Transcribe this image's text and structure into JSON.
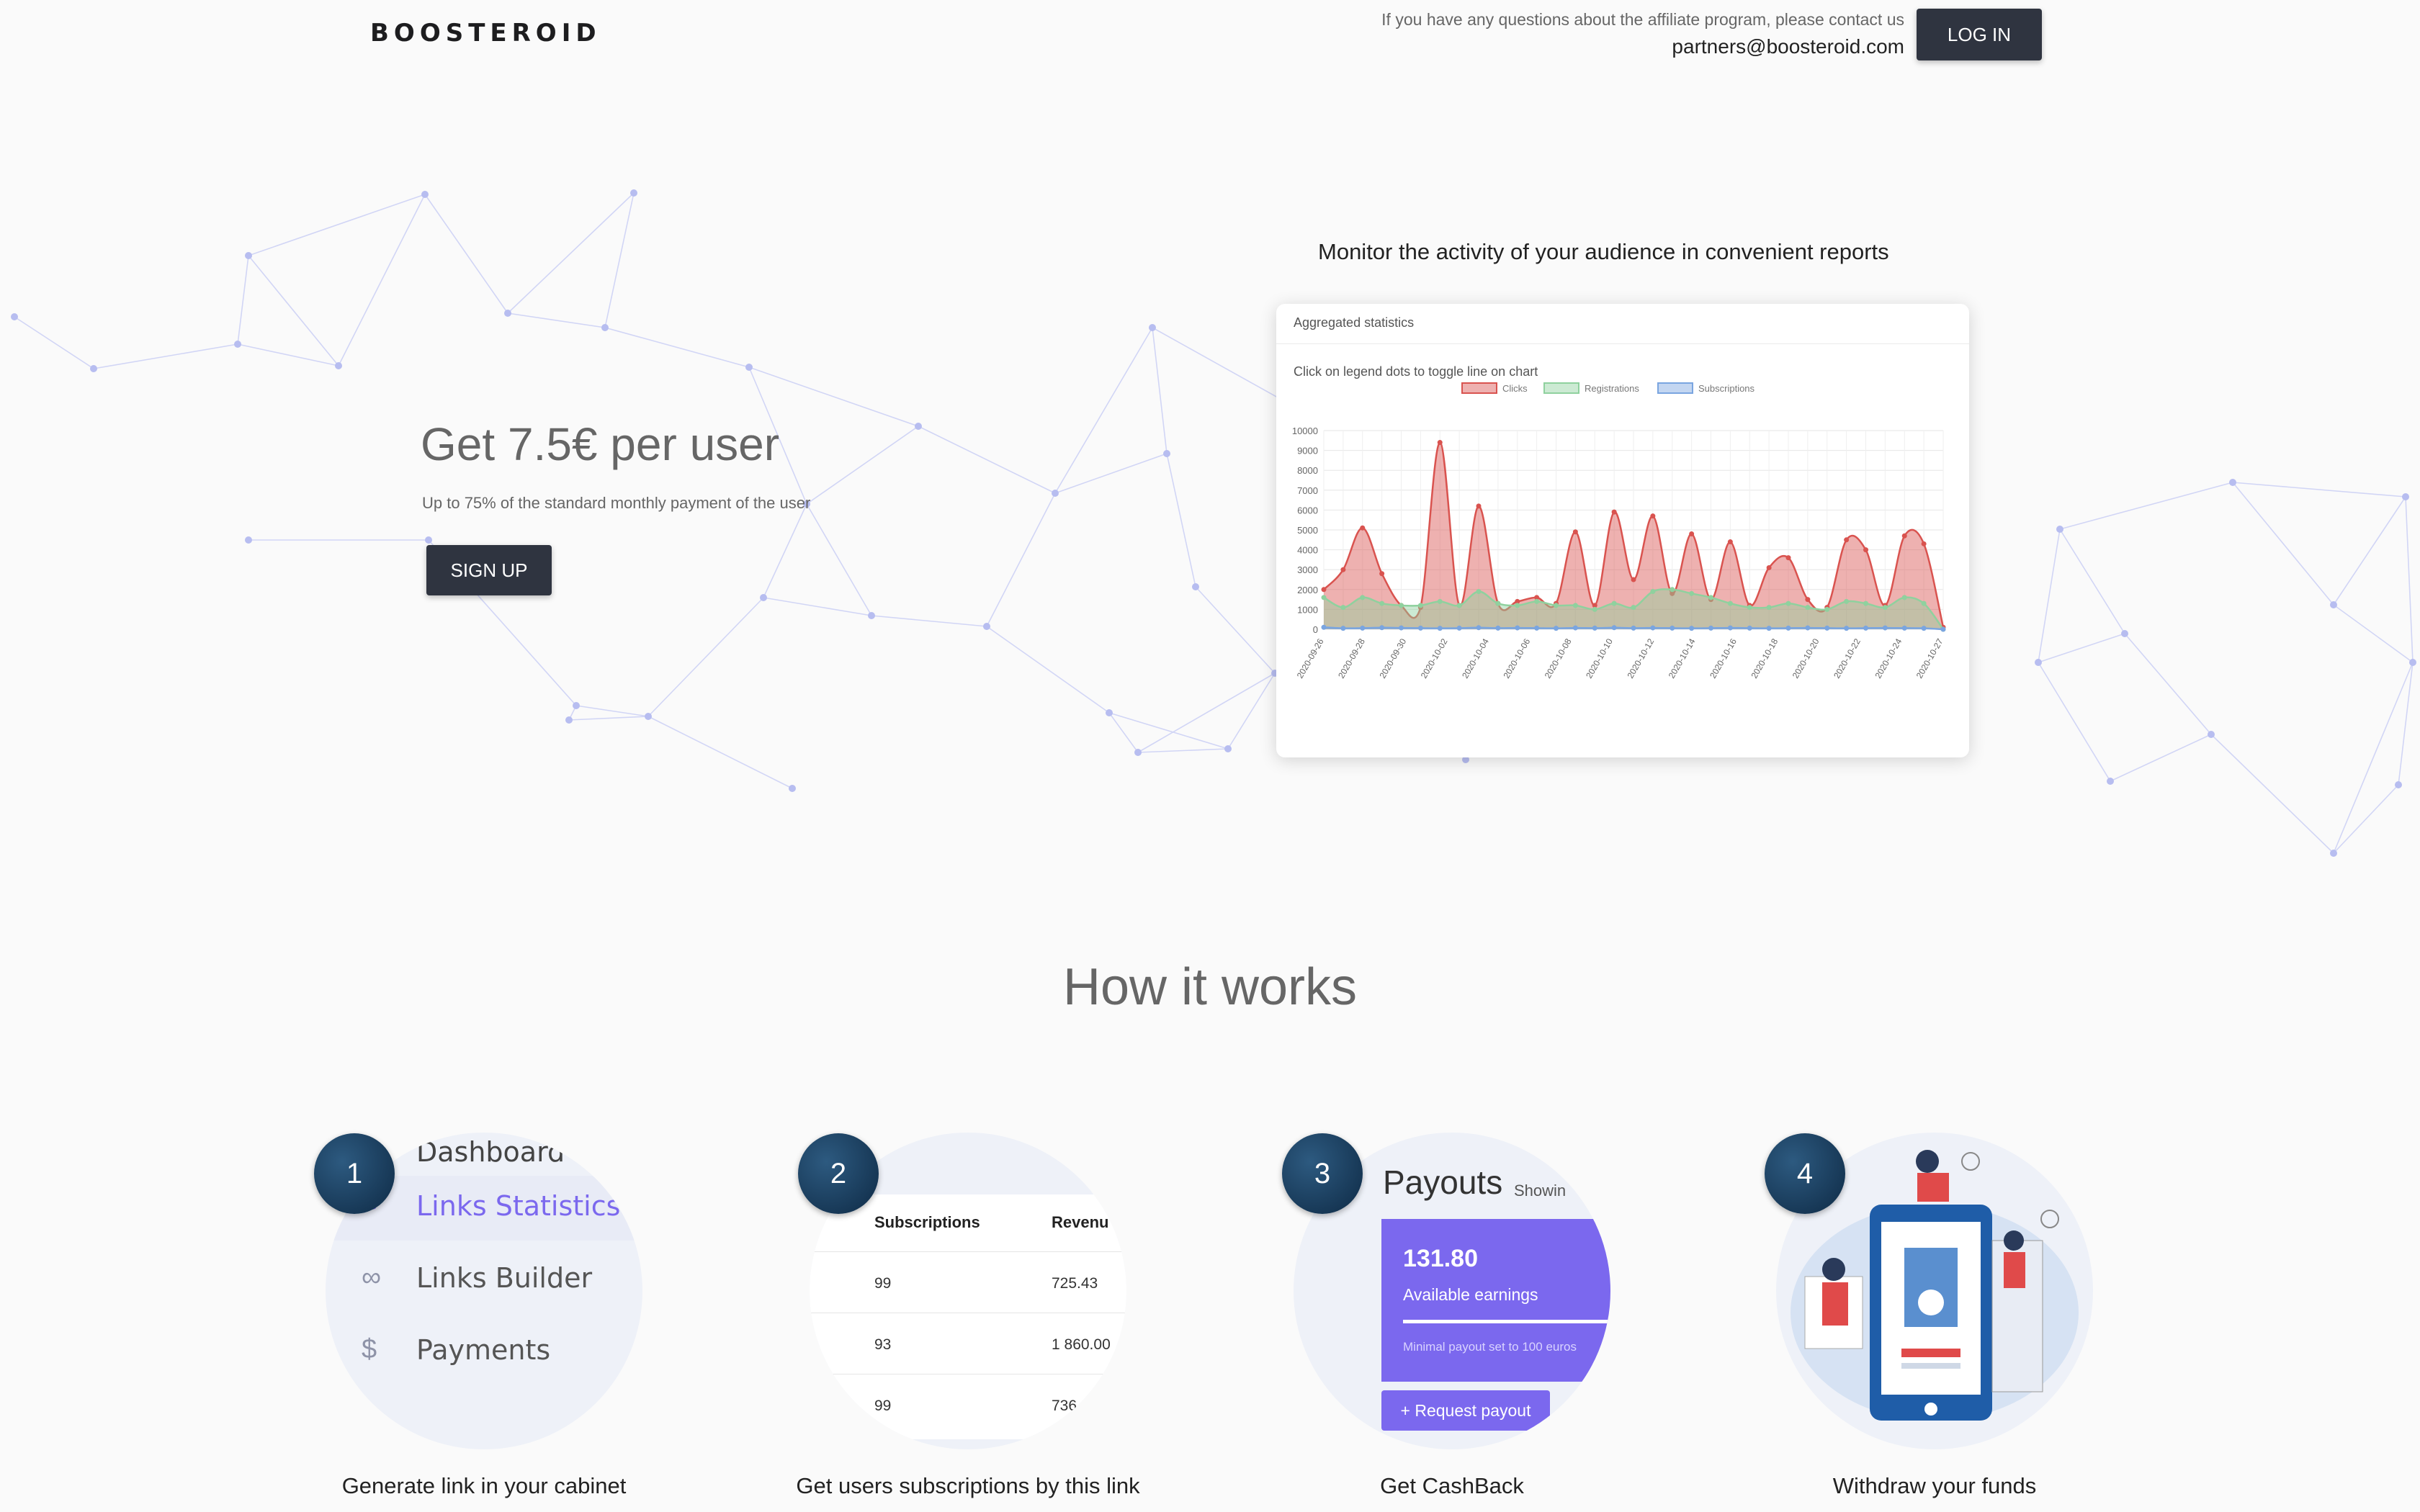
{
  "header": {
    "logo": "BOOSTEROID",
    "contact_question": "If you have any questions about the affiliate program, please contact us",
    "contact_email": "partners@boosteroid.com",
    "login_label": "LOG IN"
  },
  "hero": {
    "title": "Get 7.5€ per user",
    "subtitle": "Up to 75% of the standard monthly payment of the user",
    "signup_label": "SIGN UP"
  },
  "report": {
    "caption": "Monitor the activity of your audience in convenient reports",
    "card_title": "Aggregated statistics",
    "hint": "Click on legend dots to toggle line on chart"
  },
  "chart_data": {
    "type": "area",
    "title": "",
    "x": [
      "2020-09-26",
      "2020-09-27",
      "2020-09-28",
      "2020-09-29",
      "2020-09-30",
      "2020-10-01",
      "2020-10-02",
      "2020-10-03",
      "2020-10-04",
      "2020-10-05",
      "2020-10-06",
      "2020-10-07",
      "2020-10-08",
      "2020-10-09",
      "2020-10-10",
      "2020-10-11",
      "2020-10-12",
      "2020-10-13",
      "2020-10-14",
      "2020-10-15",
      "2020-10-16",
      "2020-10-17",
      "2020-10-18",
      "2020-10-19",
      "2020-10-20",
      "2020-10-21",
      "2020-10-22",
      "2020-10-23",
      "2020-10-24",
      "2020-10-25",
      "2020-10-26",
      "2020-10-27"
    ],
    "x_tick_labels": [
      "2020-09-26",
      "2020-09-28",
      "2020-09-30",
      "2020-10-02",
      "2020-10-04",
      "2020-10-06",
      "2020-10-08",
      "2020-10-10",
      "2020-10-12",
      "2020-10-14",
      "2020-10-16",
      "2020-10-18",
      "2020-10-20",
      "2020-10-22",
      "2020-10-24",
      "2020-10-27"
    ],
    "series": [
      {
        "name": "Clicks",
        "color": "#d9534f",
        "fill": "rgba(217,83,79,0.45)",
        "values": [
          2000,
          3000,
          5100,
          2800,
          1200,
          1100,
          9400,
          1200,
          6200,
          1300,
          1400,
          1600,
          1300,
          4900,
          1200,
          5900,
          2500,
          5700,
          1800,
          4800,
          1500,
          4400,
          1200,
          3100,
          3600,
          1500,
          1100,
          4500,
          4000,
          1200,
          4700,
          4300,
          100
        ]
      },
      {
        "name": "Registrations",
        "color": "#8fd19e",
        "fill": "rgba(143,209,158,0.45)",
        "values": [
          1600,
          1100,
          1600,
          1300,
          1200,
          1200,
          1400,
          1200,
          1900,
          1300,
          1200,
          1400,
          1200,
          1200,
          1000,
          1300,
          1100,
          1900,
          2000,
          1800,
          1600,
          1300,
          1100,
          1100,
          1300,
          1100,
          1000,
          1400,
          1300,
          1100,
          1600,
          1300,
          0
        ]
      },
      {
        "name": "Subscriptions",
        "color": "#7aa5e0",
        "fill": "rgba(122,165,224,0.45)",
        "values": [
          100,
          50,
          60,
          80,
          70,
          60,
          50,
          60,
          80,
          60,
          70,
          60,
          50,
          70,
          60,
          80,
          60,
          70,
          60,
          50,
          60,
          70,
          60,
          50,
          60,
          70,
          60,
          50,
          60,
          70,
          60,
          50,
          0
        ]
      }
    ],
    "ylim": [
      0,
      10000
    ],
    "yticks": [
      0,
      1000,
      2000,
      3000,
      4000,
      5000,
      6000,
      7000,
      8000,
      9000,
      10000
    ],
    "grid": true,
    "legend_position": "top-center"
  },
  "how": {
    "title": "How it works",
    "steps": [
      {
        "number": "1",
        "caption": "Generate link in your cabinet"
      },
      {
        "number": "2",
        "caption": "Get users subscriptions by this link"
      },
      {
        "number": "3",
        "caption": "Get CashBack"
      },
      {
        "number": "4",
        "caption": "Withdraw your funds"
      }
    ],
    "menu": [
      "Dashboard",
      "Links Statistics",
      "Links Builder",
      "Payments"
    ],
    "table": {
      "headers": [
        "Subscriptions",
        "Revenu"
      ],
      "rows": [
        [
          "99",
          "725.43"
        ],
        [
          "93",
          "1 860.00"
        ],
        [
          "99",
          "736"
        ]
      ]
    },
    "payouts": {
      "title": "Payouts",
      "showing": "Showin",
      "amount": "131.80",
      "available": "Available earnings",
      "minimal": "Minimal payout set to 100 euros",
      "request": "+ Request payout"
    }
  },
  "colors": {
    "dark_button": "#2f3440",
    "accent_purple": "#7b68ee",
    "badge": "#0e2a45"
  }
}
